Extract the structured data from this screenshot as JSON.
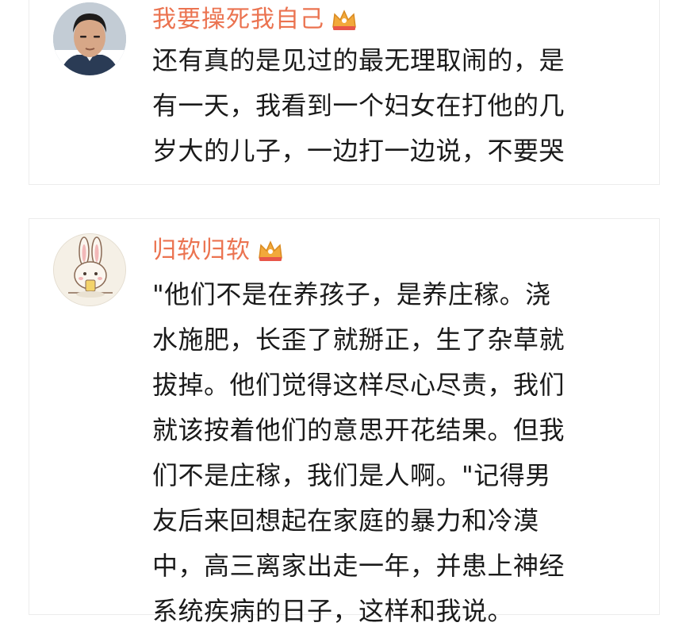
{
  "posts": [
    {
      "username": "我要操死我自己",
      "badge_icon": "crown-icon",
      "avatar": "man-portrait-avatar",
      "text_lines": [
        "还有真的是见过的最无理取闹的，是",
        "有一天，我看到一个妇女在打他的几",
        "岁大的儿子，一边打一边说，不要哭"
      ]
    },
    {
      "username": "归软归软",
      "badge_icon": "crown-icon",
      "avatar": "bunny-cartoon-avatar",
      "text_lines": [
        "\"他们不是在养孩子，是养庄稼。浇",
        "水施肥，长歪了就掰正，生了杂草就",
        "拔掉。他们觉得这样尽心尽责，我们",
        "就该按着他们的意思开花结果。但我",
        "们不是庄稼，我们是人啊。\"记得男",
        "友后来回想起在家庭的暴力和冷漠",
        "中，高三离家出走一年，并患上神经",
        "系统疾病的日子，这样和我说。"
      ]
    }
  ],
  "colors": {
    "username": "#eb7350",
    "text": "#1a1a1a",
    "crown": "#f2a93b",
    "crown_accent": "#e8564a"
  }
}
